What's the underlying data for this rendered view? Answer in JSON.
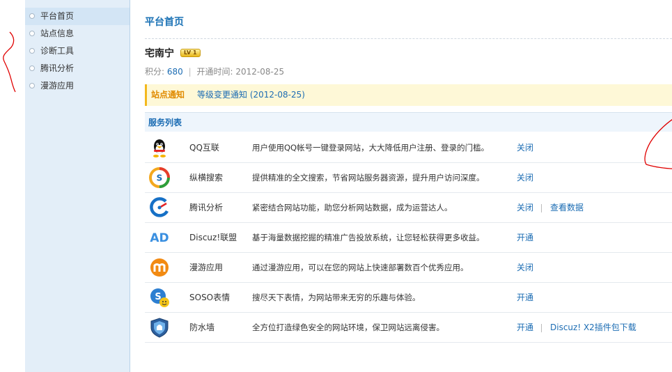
{
  "sidebar": {
    "items": [
      {
        "label": "平台首页",
        "active": true
      },
      {
        "label": "站点信息",
        "active": false
      },
      {
        "label": "诊断工具",
        "active": false
      },
      {
        "label": "腾讯分析",
        "active": false
      },
      {
        "label": "漫游应用",
        "active": false
      }
    ]
  },
  "main": {
    "title": "平台首页",
    "site_name": "宅南宁",
    "level_badge": "LV 1",
    "meta": {
      "points_label": "积分:",
      "points": "680",
      "open_time_label": "开通时间:",
      "open_time": "2012-08-25"
    },
    "notice": {
      "label": "站点通知",
      "text": "等级变更通知 (2012-08-25)"
    },
    "services_header": "服务列表",
    "services": [
      {
        "name": "QQ互联",
        "desc": "用户使用QQ帐号一键登录网站，大大降低用户注册、登录的门槛。",
        "action": "关闭",
        "extra": "",
        "icon": "qq-penguin-icon"
      },
      {
        "name": "纵横搜索",
        "desc": "提供精准的全文搜索，节省网站服务器资源，提升用户访问深度。",
        "action": "关闭",
        "extra": "",
        "icon": "soso-search-icon"
      },
      {
        "name": "腾讯分析",
        "desc": "紧密结合网站功能，助您分析网站数据，成为运营达人。",
        "action": "关闭",
        "extra": "查看数据",
        "icon": "tencent-analytics-icon"
      },
      {
        "name": "Discuz!联盟",
        "desc": "基于海量数据挖掘的精准广告投放系统，让您轻松获得更多收益。",
        "action": "开通",
        "extra": "",
        "icon": "ad-icon"
      },
      {
        "name": "漫游应用",
        "desc": "通过漫游应用，可以在您的网站上快速部署数百个优秀应用。",
        "action": "关闭",
        "extra": "",
        "icon": "manyou-icon"
      },
      {
        "name": "SOSO表情",
        "desc": "搜尽天下表情，为网站带来无穷的乐趣与体验。",
        "action": "开通",
        "extra": "",
        "icon": "soso-emoticon-icon"
      },
      {
        "name": "防水墙",
        "desc": "全方位打造绿色安全的网站环境，保卫网站远离侵害。",
        "action": "开通",
        "extra": "Discuz! X2插件包下载",
        "icon": "firewall-shield-icon"
      }
    ]
  },
  "colors": {
    "link": "#1b6cb3",
    "sidebar_bg": "#e3eef8",
    "notice_bg": "#fef8d7",
    "notice_accent": "#e08a00",
    "annotation": "#e00000"
  }
}
